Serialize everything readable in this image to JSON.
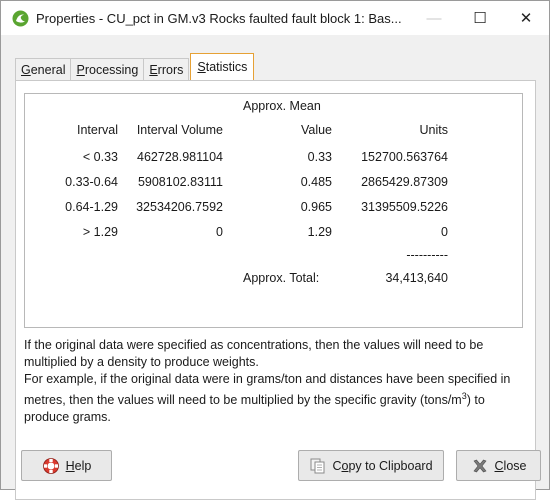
{
  "window": {
    "title": "Properties - CU_pct in GM.v3 Rocks faulted fault block 1: Bas...",
    "controls": {
      "minimize": "—",
      "maximize": "☐",
      "close": "✕"
    }
  },
  "tabs": [
    {
      "pre": "",
      "u": "G",
      "post": "eneral"
    },
    {
      "pre": "",
      "u": "P",
      "post": "rocessing"
    },
    {
      "pre": "",
      "u": "E",
      "post": "rrors"
    },
    {
      "pre": "",
      "u": "S",
      "post": "tatistics"
    }
  ],
  "stats": {
    "header_top": "Approx. Mean",
    "columns": [
      "Interval",
      "Interval Volume",
      "Value",
      "Units"
    ],
    "rows": [
      [
        "< 0.33",
        "462728.981104",
        "0.33",
        "152700.563764"
      ],
      [
        "0.33-0.64",
        "5908102.83111",
        "0.485",
        "2865429.87309"
      ],
      [
        "0.64-1.29",
        "32534206.7592",
        "0.965",
        "31395509.5226"
      ],
      [
        "> 1.29",
        "0",
        "1.29",
        "0"
      ]
    ],
    "separator": "----------",
    "total_label": "Approx. Total:",
    "total_value": "34,413,640"
  },
  "note": {
    "line1": "If the original data were specified as concentrations, then the values will need to be multiplied by a density to produce weights.",
    "line2_pre": "For example, if the original data were in grams/ton and distances have been specified in metres, then the values will need to be multiplied by the specific gravity (tons/m",
    "line2_sup": "3",
    "line2_post": ") to produce grams."
  },
  "buttons": {
    "help": {
      "u": "H",
      "rest": "elp"
    },
    "copy": {
      "pre": "C",
      "u": "o",
      "rest": "py to Clipboard"
    },
    "close": {
      "u": "C",
      "rest": "lose"
    }
  },
  "colors": {
    "active_tab_border": "#e6a135",
    "app_icon": "#5aa531"
  }
}
